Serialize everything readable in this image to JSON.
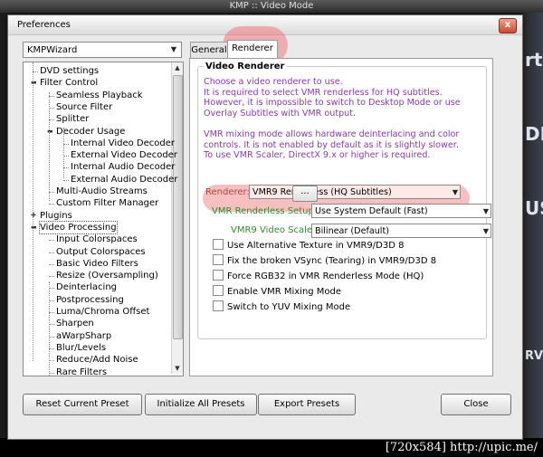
{
  "background_app": {
    "title": "KMP :: Video Mode",
    "side_fragments": [
      "rt",
      "DI",
      "US",
      "RVI"
    ],
    "watermark": "[720x584] http://upic.me/"
  },
  "dialog": {
    "title": "Preferences",
    "close_glyph": "x",
    "preset": {
      "value": "KMPWizard"
    },
    "tree": [
      {
        "label": "DVD settings"
      },
      {
        "label": "Filter Control",
        "expander": "minus"
      },
      {
        "label": "Seamless Playback"
      },
      {
        "label": "Source Filter"
      },
      {
        "label": "Splitter"
      },
      {
        "label": "Decoder Usage",
        "expander": "minus"
      },
      {
        "label": "Internal Video Decoder"
      },
      {
        "label": "External Video Decoder"
      },
      {
        "label": "Internal Audio Decoder"
      },
      {
        "label": "External Audio Decoder"
      },
      {
        "label": "Multi-Audio Streams"
      },
      {
        "label": "Custom Filter Manager"
      },
      {
        "label": "Plugins",
        "expander": "plus"
      },
      {
        "label": "Video Processing",
        "expander": "minus",
        "selected": true
      },
      {
        "label": "Input Colorspaces"
      },
      {
        "label": "Output Colorspaces"
      },
      {
        "label": "Basic Video Filters"
      },
      {
        "label": "Resize (Oversampling)"
      },
      {
        "label": "Deinterlacing"
      },
      {
        "label": "Postprocessing"
      },
      {
        "label": "Luma/Chroma Offset"
      },
      {
        "label": "Sharpen"
      },
      {
        "label": "aWarpSharp"
      },
      {
        "label": "Blur/Levels"
      },
      {
        "label": "Reduce/Add Noise"
      },
      {
        "label": "Rare Filters"
      }
    ],
    "tabs": [
      {
        "label": "General",
        "active": false
      },
      {
        "label": "Renderer",
        "active": true
      }
    ],
    "group_title": "Video Renderer",
    "info_lines": [
      "Choose a video renderer to use.",
      "It is required to select VMR renderless for HQ subtitles.",
      "However, it is impossible to switch to Desktop Mode or use",
      "Overlay Subtitles with VMR output.",
      "",
      "VMR mixing mode allows hardware deinterlacing and color",
      "controls. It is not enabled by default as it is slightly slower.",
      "To use VMR Scaler, DirectX 9.x or higher is required."
    ],
    "renderer": {
      "label": "Renderer:",
      "value": "VMR9 Renderless (HQ Subtitles)",
      "more_label": "..."
    },
    "setup": {
      "label": "VMR Renderless Setup:",
      "value": "Use System Default (Fast)"
    },
    "scaler": {
      "label": "VMR9 Video Scaler:",
      "value": "Bilinear (Default)"
    },
    "checkboxes": [
      {
        "label": "Use Alternative Texture in VMR9/D3D 8",
        "checked": false
      },
      {
        "label": "Fix the broken VSync (Tearing) in VMR9/D3D 8",
        "checked": false
      },
      {
        "label": "Force RGB32 in VMR Renderless Mode (HQ)",
        "checked": false
      },
      {
        "label": "Enable VMR Mixing Mode",
        "checked": false
      },
      {
        "label": "Switch to YUV Mixing Mode",
        "checked": false
      }
    ],
    "buttons": {
      "reset": "Reset Current Preset",
      "init": "Initialize All Presets",
      "export": "Export Presets",
      "close": "Close"
    }
  },
  "colors": {
    "info_text": "#8b3ab0",
    "label_green": "#2e8b2e",
    "label_red": "#b84040",
    "highlight": "#f08282"
  }
}
